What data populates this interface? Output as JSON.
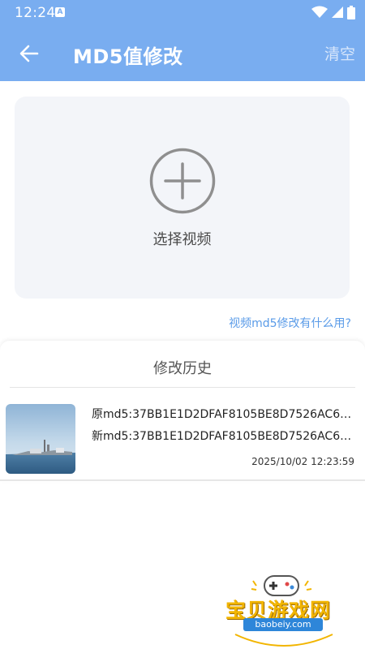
{
  "status_bar": {
    "time": "12:24",
    "notification_badge": "A",
    "icons": [
      "wifi-icon",
      "cellular-icon",
      "battery-icon"
    ]
  },
  "app_bar": {
    "title": "MD5值修改",
    "clear_label": "清空"
  },
  "upload": {
    "label": "选择视频"
  },
  "help_link": "视频md5修改有什么用?",
  "history": {
    "title": "修改历史",
    "items": [
      {
        "original_md5": "原md5:37BB1E1D2DFAF8105BE8D7526AC620...",
        "new_md5": "新md5:37BB1E1D2DFAF8105BE8D7526AC620...",
        "timestamp": "2025/10/02 12:23:59"
      }
    ]
  },
  "watermark": {
    "name": "宝贝游戏网",
    "url": "baobeiy.com"
  },
  "colors": {
    "primary": "#79adf0",
    "link": "#5a9be8",
    "card_bg": "#f3f5f9"
  }
}
